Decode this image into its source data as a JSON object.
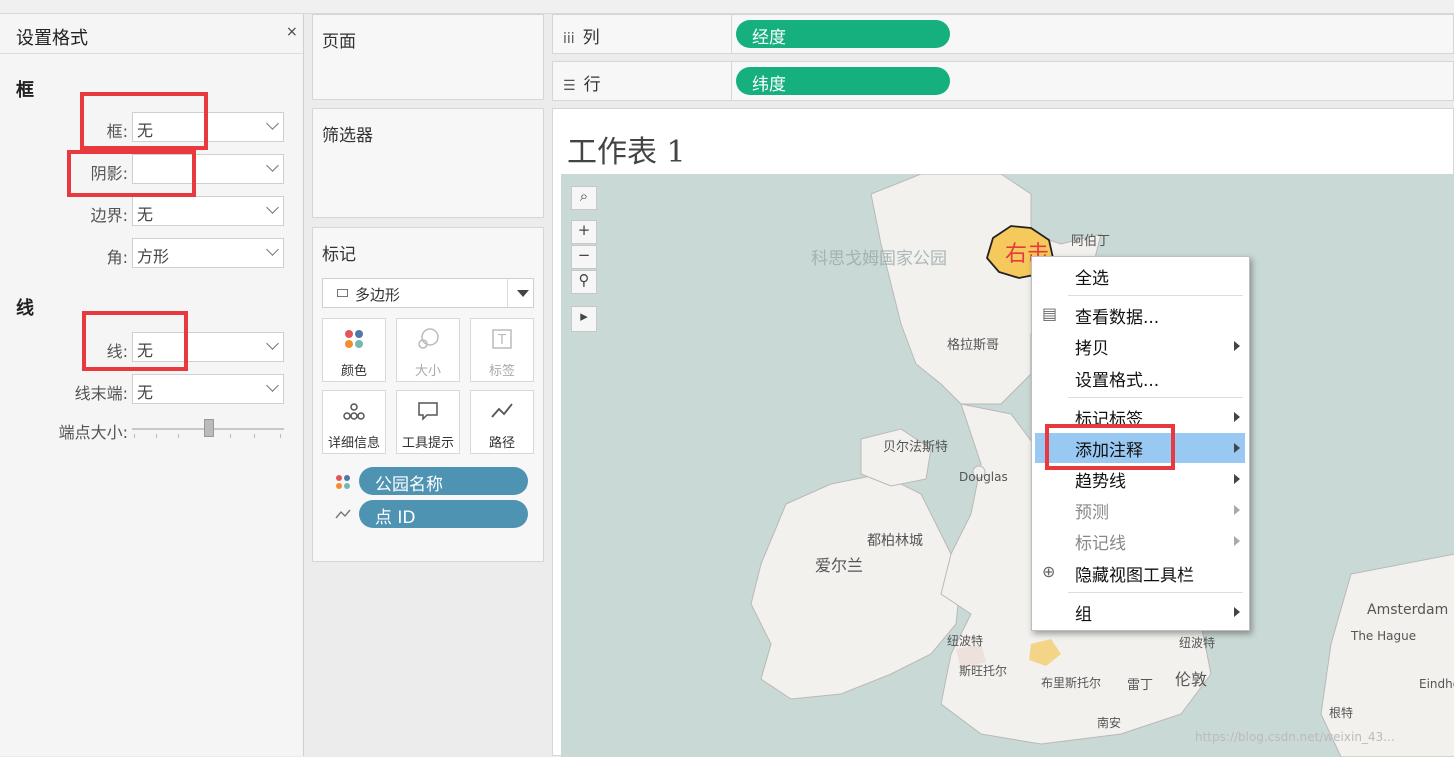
{
  "format_pane": {
    "title": "设置格式",
    "close": "×",
    "border_section": "框",
    "border_label": "框:",
    "border_value": "无",
    "shadow_label": "阴影:",
    "shadow_value": "",
    "edge_label": "边界:",
    "edge_value": "无",
    "corner_label": "角:",
    "corner_value": "方形",
    "line_section": "线",
    "line_label": "线:",
    "line_value": "无",
    "line_end_label": "线末端:",
    "line_end_value": "无",
    "endpoint_size_label": "端点大小:"
  },
  "pages_card": {
    "title": "页面"
  },
  "filters_card": {
    "title": "筛选器"
  },
  "marks_card": {
    "title": "标记",
    "mark_type": "多边形",
    "buttons": [
      {
        "label": "颜色",
        "icon": "color-icon"
      },
      {
        "label": "大小",
        "icon": "size-icon"
      },
      {
        "label": "标签",
        "icon": "label-icon"
      },
      {
        "label": "详细信息",
        "icon": "detail-icon"
      },
      {
        "label": "工具提示",
        "icon": "tooltip-icon"
      },
      {
        "label": "路径",
        "icon": "path-icon"
      }
    ],
    "fields": [
      {
        "label": "公园名称",
        "icon": "color-dots-icon"
      },
      {
        "label": "点 ID",
        "icon": "path-line-icon"
      }
    ]
  },
  "shelves": {
    "columns_label": "列",
    "columns_pill": "经度",
    "rows_label": "行",
    "rows_pill": "纬度"
  },
  "worksheet": {
    "title": "工作表 1",
    "map_labels": {
      "park_name": "科思戈姆国家公园",
      "right_click": "右击",
      "aberdeen": "阿伯丁",
      "glasgow": "格拉斯哥",
      "belfast": "贝尔法斯特",
      "douglas": "Douglas",
      "dublin": "都柏林城",
      "ireland": "爱尔兰",
      "plymouth_left": "纽波特",
      "newport": "斯旺托尔",
      "bristol": "布里斯托尔",
      "reading": "雷丁",
      "london": "伦敦",
      "newport2": "纽波特",
      "southampton": "南安",
      "amsterdam": "Amsterdam",
      "hague": "The Hague",
      "eindhoven": "Eindhov",
      "antwerp": "根特",
      "watermark": "https://blog.csdn.net/weixin_43..."
    }
  },
  "context_menu": {
    "items": [
      {
        "label": "全选",
        "submenu": false,
        "disabled": false
      },
      {
        "label": "查看数据...",
        "submenu": false,
        "disabled": false,
        "icon": "table-icon"
      },
      {
        "label": "拷贝",
        "submenu": true,
        "disabled": false
      },
      {
        "label": "设置格式...",
        "submenu": false,
        "disabled": false
      },
      {
        "label": "标记标签",
        "submenu": true,
        "disabled": false
      },
      {
        "label": "添加注释",
        "submenu": true,
        "disabled": false,
        "highlighted": true
      },
      {
        "label": "趋势线",
        "submenu": true,
        "disabled": false
      },
      {
        "label": "预测",
        "submenu": true,
        "disabled": true
      },
      {
        "label": "标记线",
        "submenu": true,
        "disabled": true
      },
      {
        "label": "隐藏视图工具栏",
        "submenu": false,
        "disabled": false,
        "icon": "zoom-icon"
      },
      {
        "label": "组",
        "submenu": true,
        "disabled": false
      }
    ]
  },
  "colors": {
    "annotation_red": "#e8393e",
    "pill_green": "#15b07e",
    "pill_blue": "#4f93b3",
    "menu_highlight": "#99c8f2",
    "selected_region": "#f5c95c"
  }
}
